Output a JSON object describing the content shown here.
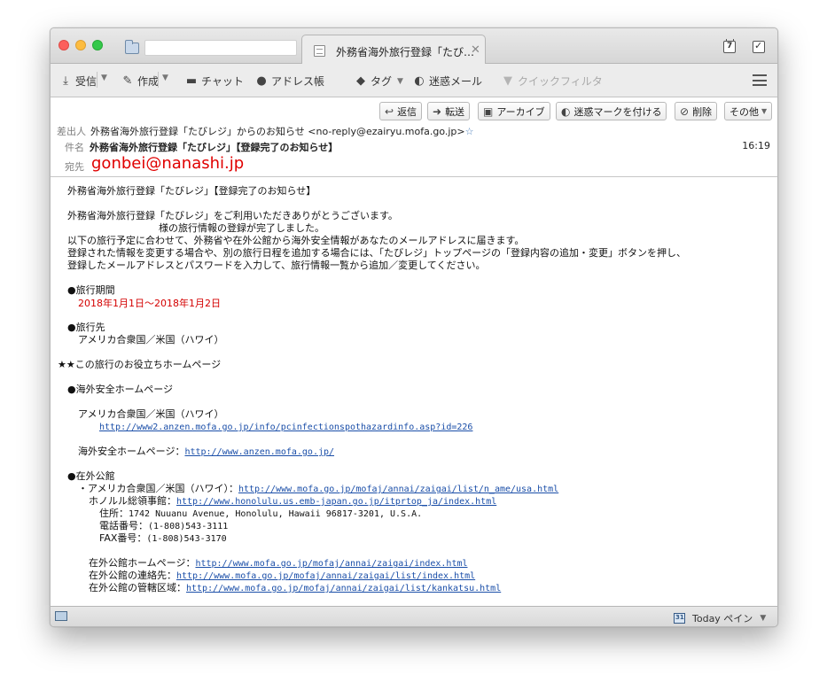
{
  "window": {
    "tab_title": "外務省海外旅行登録「たび…",
    "tab_close": "✕",
    "tab_input_value": ""
  },
  "toolbar": {
    "receive": "受信",
    "compose": "作成",
    "chat": "チャット",
    "address_book": "アドレス帳",
    "tag": "タグ",
    "junk": "迷惑メール",
    "quick_filter": "クイックフィルタ",
    "dropdown_glyph": "▼"
  },
  "header": {
    "buttons": {
      "reply": "返信",
      "forward": "転送",
      "archive": "アーカイブ",
      "mark_junk": "迷惑マークを付ける",
      "delete": "削除",
      "other": "その他"
    },
    "from_label": "差出人",
    "from_value": "外務省海外旅行登録「たびレジ」からのお知らせ <no-reply@ezairyu.mofa.go.jp>",
    "from_star": "☆",
    "subject_label": "件名",
    "subject_value": "外務省海外旅行登録「たびレジ」【登録完了のお知らせ】",
    "time": "16:19",
    "to_label": "宛先",
    "to_value": "gonbei@nanashi.jp"
  },
  "body": {
    "title": "外務省海外旅行登録「たびレジ」【登録完了のお知らせ】",
    "p1": "外務省海外旅行登録「たびレジ」をご利用いただきありがとうございます。",
    "p2": "様の旅行情報の登録が完了しました。",
    "p3": "以下の旅行予定に合わせて、外務省や在外公館から海外安全情報があなたのメールアドレスに届きます。",
    "p4": "登録された情報を変更する場合や、別の旅行日程を追加する場合には、「たびレジ」トップページの「登録内容の追加・変更」ボタンを押し、",
    "p5": "登録したメールアドレスとパスワードを入力して、旅行情報一覧から追加／変更してください。",
    "period_heading": "●旅行期間",
    "period_value": "2018年1月1日～2018年1月2日",
    "dest_heading": "●旅行先",
    "dest_value": "アメリカ合衆国／米国（ハワイ）",
    "useful_heading": "★★この旅行のお役立ちホームページ",
    "safety_heading": "●海外安全ホームページ",
    "safety_country": "アメリカ合衆国／米国（ハワイ）",
    "safety_country_url": "http://www2.anzen.mofa.go.jp/info/pcinfectionspothazardinfo.asp?id=226",
    "safety_home_label": "海外安全ホームページ：",
    "safety_home_url": "http://www.anzen.mofa.go.jp/",
    "mission_heading": "●在外公館",
    "mission_country_label": "・アメリカ合衆国／米国（ハワイ）：",
    "mission_country_url": "http://www.mofa.go.jp/mofaj/annai/zaigai/list/n_ame/usa.html",
    "consulate_label": "ホノルル総領事館：",
    "consulate_url": "http://www.honolulu.us.emb-japan.go.jp/itprtop_ja/index.html",
    "address_label": "住所：",
    "address_value": "1742 Nuuanu Avenue, Honolulu, Hawaii 96817-3201, U.S.A.",
    "phone_label": "電話番号：",
    "phone_value": "(1-808)543-3111",
    "fax_label": "FAX番号：",
    "fax_value": "(1-808)543-3170",
    "mission_home_label": "在外公館ホームページ：",
    "mission_home_url": "http://www.mofa.go.jp/mofaj/annai/zaigai/index.html",
    "mission_contact_label": "在外公館の連絡先：",
    "mission_contact_url": "http://www.mofa.go.jp/mofaj/annai/zaigai/list/index.html",
    "mission_area_label": "在外公館の管轄区域：",
    "mission_area_url": "http://www.mofa.go.jp/mofaj/annai/zaigai/list/kankatsu.html"
  },
  "statusbar": {
    "today_pane": "Today ペイン",
    "dropdown_glyph": "▼"
  },
  "colors": {
    "recipient": "#e00000",
    "period": "#d40000",
    "link": "#1a4ea8"
  }
}
